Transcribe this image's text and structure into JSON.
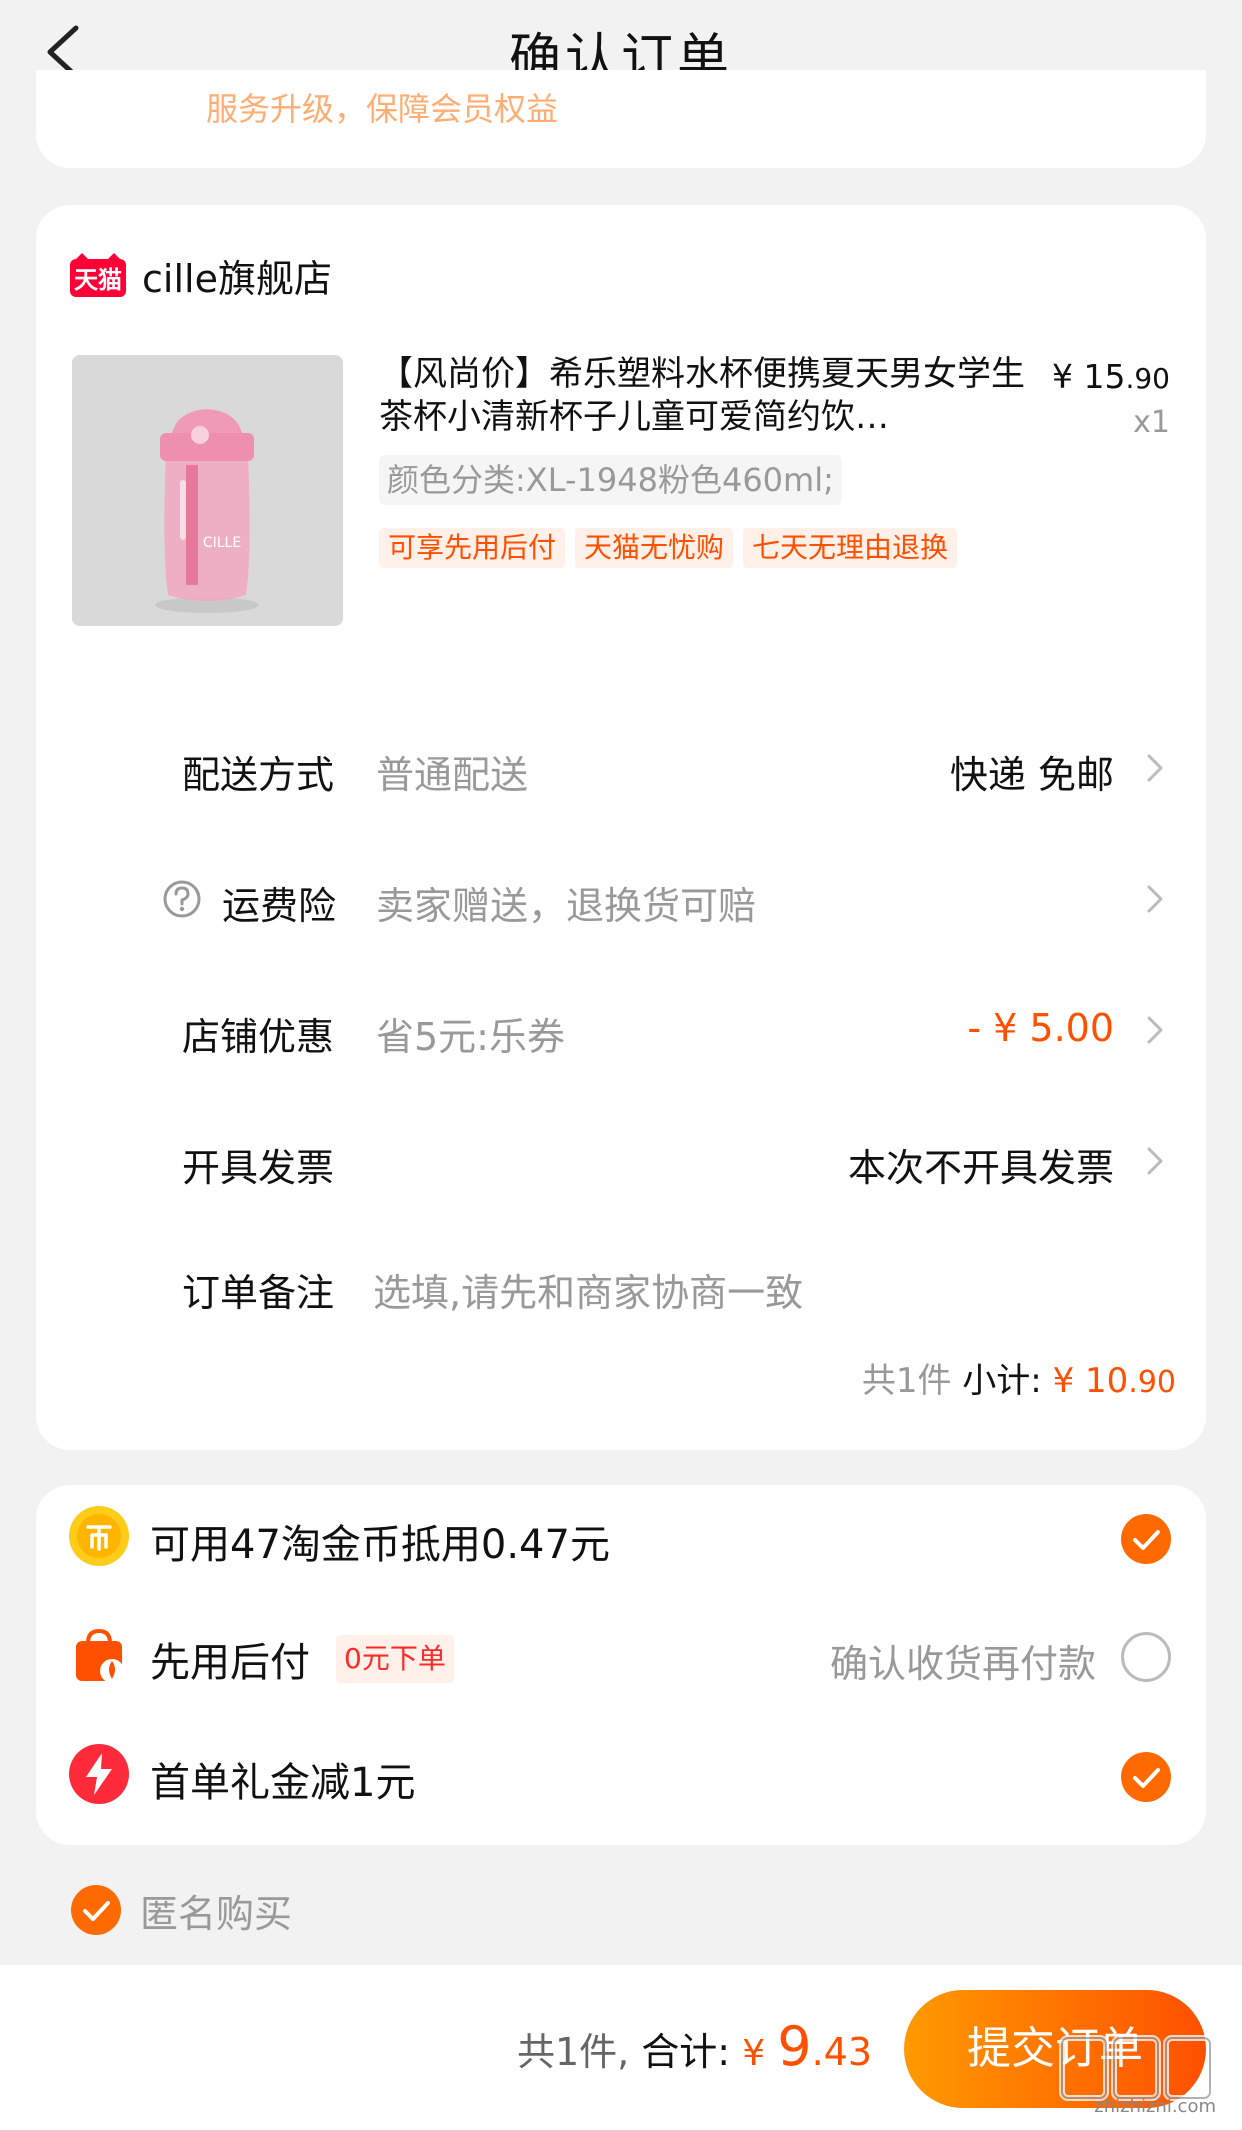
{
  "header": {
    "title": "确认订单"
  },
  "top_card": {
    "partial_text": "服务升级，保障会员权益"
  },
  "shop": {
    "logo_text": "天猫",
    "name": "cille旗舰店",
    "product": {
      "title": "【风尚价】希乐塑料水杯便携夏天男女学生茶杯小清新杯子儿童可爱简约饮…",
      "image_text": "CILLE",
      "price_symbol": "¥",
      "price_int": "15",
      "price_dec": ".90",
      "qty": "x1",
      "sku": "颜色分类:XL-1948粉色460ml;",
      "tags": [
        "可享先用后付",
        "天猫无忧购",
        "七天无理由退换"
      ]
    },
    "rows": {
      "delivery": {
        "label": "配送方式",
        "value": "普通配送",
        "right": "快递 免邮"
      },
      "insurance": {
        "label": "运费险",
        "value": "卖家赠送，退换货可赔"
      },
      "discount": {
        "label": "店铺优惠",
        "value": "省5元:乐券",
        "right": "- ¥ 5.00"
      },
      "invoice": {
        "label": "开具发票",
        "right": "本次不开具发票"
      },
      "note": {
        "label": "订单备注",
        "placeholder": "选填,请先和商家协商一致"
      }
    },
    "subtotal": {
      "count": "共1件",
      "label": "小计:",
      "symbol": "¥",
      "int": "10",
      "dec": ".90"
    }
  },
  "payment": {
    "coins": {
      "icon": "coin-icon",
      "text": "可用47淘金币抵用0.47元",
      "checked": true
    },
    "later": {
      "icon": "bag-icon",
      "text": "先用后付",
      "badge": "0元下单",
      "right": "确认收货再付款",
      "checked": false
    },
    "gift": {
      "icon": "lightning-icon",
      "text": "首单礼金减1元",
      "checked": true
    }
  },
  "anonymous": {
    "label": "匿名购买",
    "checked": true
  },
  "bottom": {
    "count": "共1件,",
    "label": "合计:",
    "symbol": "¥",
    "int": "9",
    "dec": ".43",
    "submit_label": "提交订单"
  },
  "watermark": {
    "text": "zhizhizhi.com"
  },
  "colors": {
    "accent": "#ff5000",
    "accent_light": "#ff9a00",
    "tmall_red": "#ff0036"
  }
}
